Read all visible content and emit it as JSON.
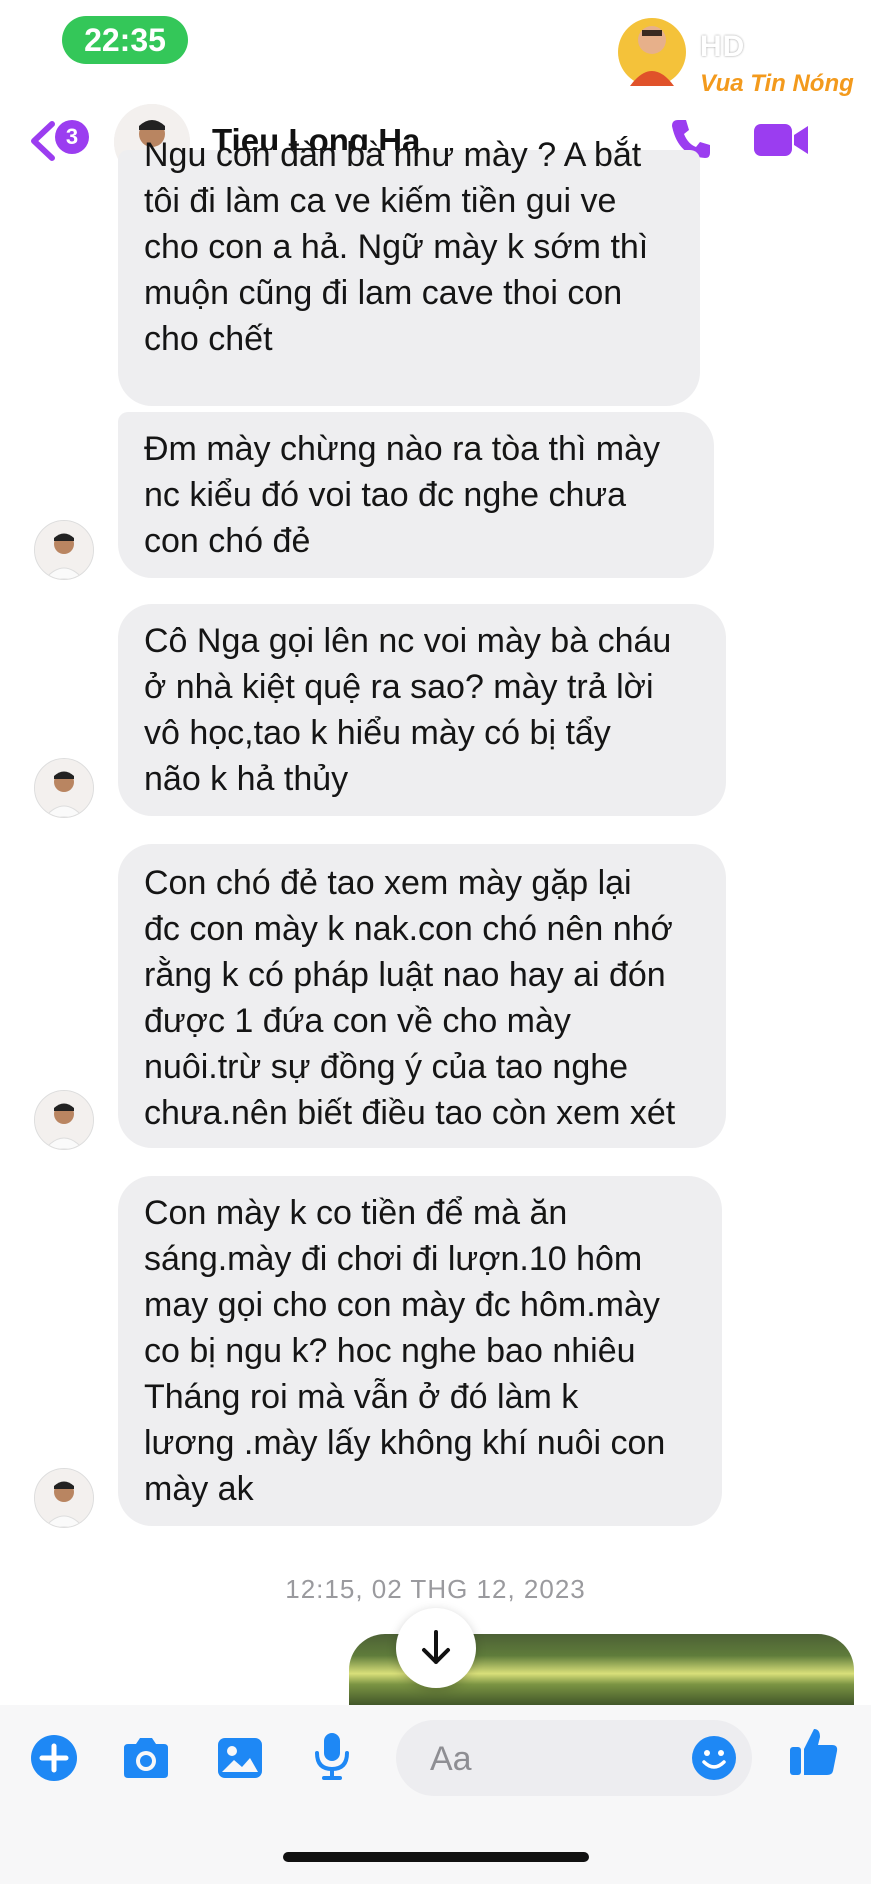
{
  "status_bar": {
    "time": "22:35",
    "hd_label": "HD"
  },
  "watermark": {
    "text": "Vua Tin Nóng"
  },
  "header": {
    "unread_count": "3",
    "contact_name": "Tieu Long Ha",
    "accent_color": "#9b3df0"
  },
  "messages": [
    {
      "lines": [
        "Ngu con đàn bà như mày ? A bắt",
        "tôi đi làm ca ve kiếm tiền gui ve",
        "cho con a hả. Ngữ mày k sớm thì",
        "muộn cũng đi lam cave thoi con",
        "cho chết"
      ]
    },
    {
      "lines": [
        "Đm mày chừng nào ra tòa thì mày",
        "nc kiểu đó voi tao đc nghe chưa",
        "con chó đẻ"
      ]
    },
    {
      "lines": [
        "Cô Nga gọi lên nc voi mày bà cháu",
        "ở nhà kiệt quệ ra sao? mày trả lời",
        "vô học,tao k hiểu mày có bị tẩy",
        "não k hả thủy"
      ]
    },
    {
      "lines": [
        "Con chó đẻ tao xem mày gặp lại",
        "đc con mày k nak.con chó nên nhớ",
        "rằng k có pháp luật nao hay ai đón",
        "được 1 đứa con về cho mày",
        "nuôi.trừ sự đồng ý của tao nghe",
        "chưa.nên biết điều tao còn xem xét"
      ]
    },
    {
      "lines": [
        "Con mày k co tiền để mà ăn",
        "sáng.mày đi chơi đi lượn.10 hôm",
        "may gọi cho con mày đc hôm.mày",
        "co bị ngu k? hoc nghe bao nhiêu",
        "Tháng roi mà vẫn ở đó làm k",
        "lương .mày lấy không khí nuôi con",
        "mày ak"
      ]
    }
  ],
  "timestamp": "12:15, 02 THG 12, 2023",
  "composer": {
    "placeholder": "Aa",
    "icons": [
      "plus-icon",
      "camera-icon",
      "image-icon",
      "microphone-icon",
      "emoji-icon",
      "thumbs-up-icon"
    ],
    "icon_color": "#1e88f5"
  }
}
